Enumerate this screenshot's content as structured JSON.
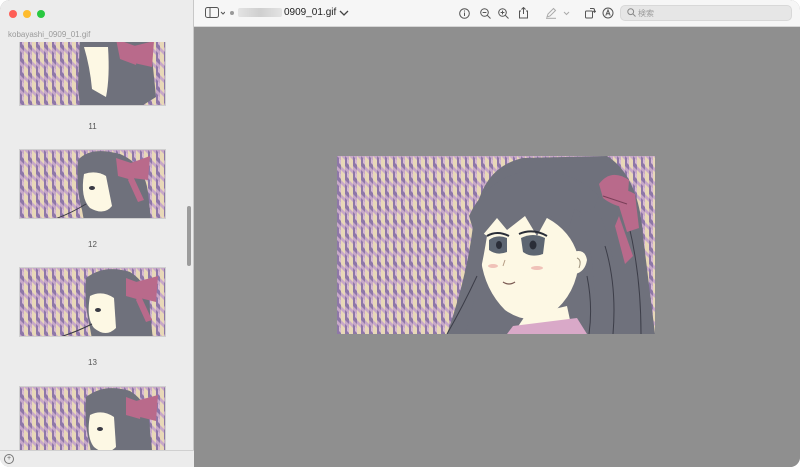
{
  "sidebar": {
    "title": "kobayashi_0909_01.gif",
    "thumbnails": [
      {
        "label": "11"
      },
      {
        "label": "12"
      },
      {
        "label": "13"
      },
      {
        "label": ""
      }
    ]
  },
  "toolbar": {
    "title_suffix": "0909_01.gif",
    "search_placeholder": "検索"
  },
  "colors": {
    "hair": "#6f717c",
    "bow": "#b96a8b",
    "skin": "#fdf8e4",
    "pattern_base": "#c7a8c8",
    "pattern_light": "#e8d8b8",
    "pattern_dark": "#8e77a8",
    "canvas": "#8f8f8f"
  },
  "icons": [
    "sidebar-toggle-icon",
    "chevron-down-icon",
    "info-icon",
    "zoom-out-icon",
    "zoom-in-icon",
    "share-icon",
    "markup-pen-icon",
    "rotate-icon",
    "annotate-icon",
    "search-icon"
  ]
}
